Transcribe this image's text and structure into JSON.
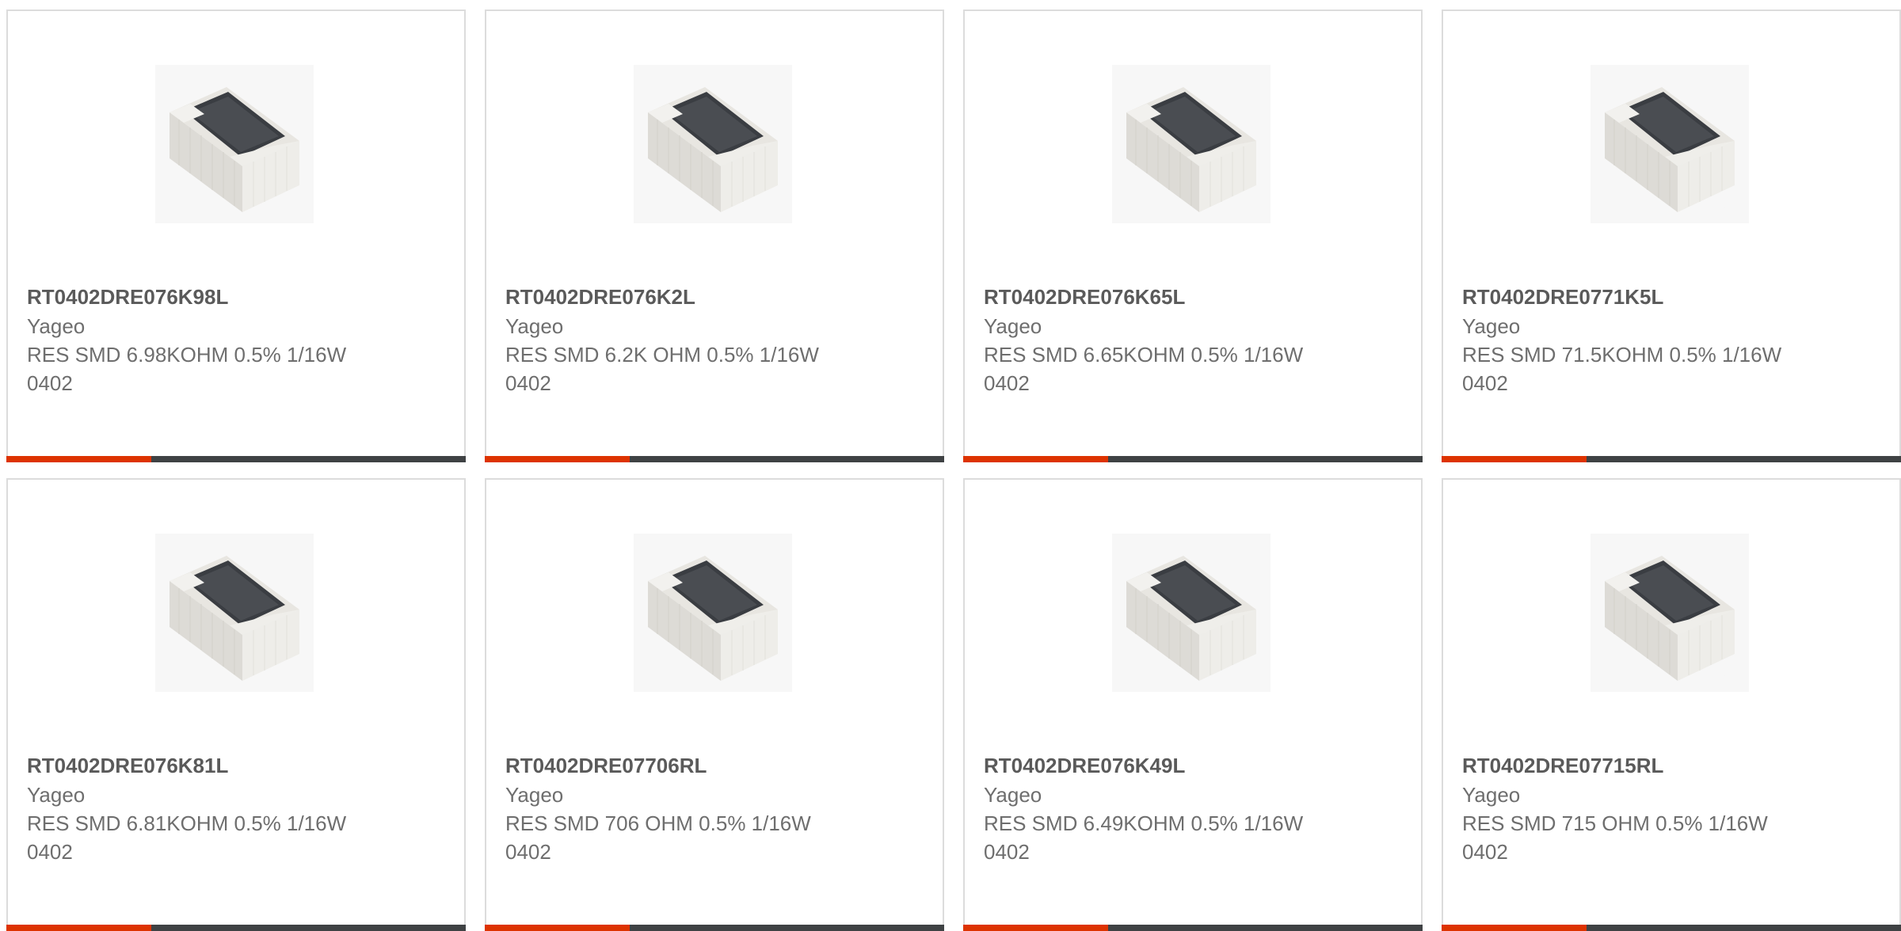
{
  "colors": {
    "accent": "#dd3300",
    "bar_dark": "#3f4244",
    "card_border": "#dcdcdc",
    "text": "#6e6e6e"
  },
  "products": [
    {
      "part_number": "RT0402DRE076K98L",
      "manufacturer": "Yageo",
      "description": "RES SMD 6.98KOHM 0.5% 1/16W 0402",
      "image_icon": "smd-resistor-0402-image"
    },
    {
      "part_number": "RT0402DRE076K2L",
      "manufacturer": "Yageo",
      "description": "RES SMD 6.2K OHM 0.5% 1/16W 0402",
      "image_icon": "smd-resistor-0402-image"
    },
    {
      "part_number": "RT0402DRE076K65L",
      "manufacturer": "Yageo",
      "description": "RES SMD 6.65KOHM 0.5% 1/16W 0402",
      "image_icon": "smd-resistor-0402-image"
    },
    {
      "part_number": "RT0402DRE0771K5L",
      "manufacturer": "Yageo",
      "description": "RES SMD 71.5KOHM 0.5% 1/16W 0402",
      "image_icon": "smd-resistor-0402-image"
    },
    {
      "part_number": "RT0402DRE076K81L",
      "manufacturer": "Yageo",
      "description": "RES SMD 6.81KOHM 0.5% 1/16W 0402",
      "image_icon": "smd-resistor-0402-image"
    },
    {
      "part_number": "RT0402DRE07706RL",
      "manufacturer": "Yageo",
      "description": "RES SMD 706 OHM 0.5% 1/16W 0402",
      "image_icon": "smd-resistor-0402-image"
    },
    {
      "part_number": "RT0402DRE076K49L",
      "manufacturer": "Yageo",
      "description": "RES SMD 6.49KOHM 0.5% 1/16W 0402",
      "image_icon": "smd-resistor-0402-image"
    },
    {
      "part_number": "RT0402DRE07715RL",
      "manufacturer": "Yageo",
      "description": "RES SMD 715 OHM 0.5% 1/16W 0402",
      "image_icon": "smd-resistor-0402-image"
    }
  ]
}
